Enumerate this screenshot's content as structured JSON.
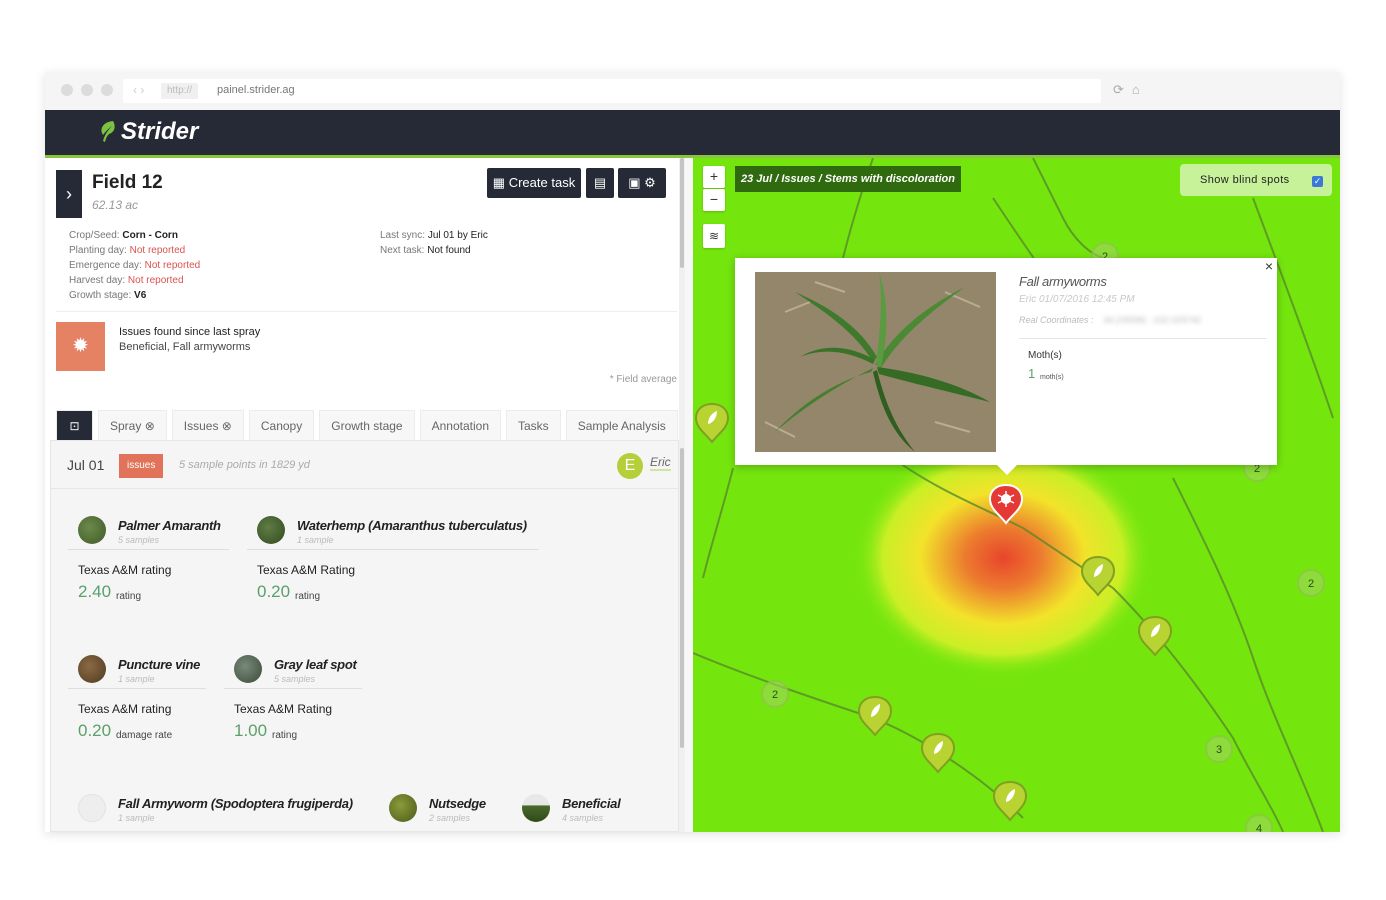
{
  "browser": {
    "protocol": "http://",
    "url": "painel.strider.ag"
  },
  "app": {
    "logo_text": "Strider"
  },
  "field": {
    "name": "Field 12",
    "area": "62.13 ac",
    "create_task_label": "Create task",
    "details": {
      "crop_label": "Crop/Seed:",
      "crop_value": "Corn - Corn",
      "planting_label": "Planting day:",
      "planting_value": "Not reported",
      "emergence_label": "Emergence day:",
      "emergence_value": "Not reported",
      "harvest_label": "Harvest day:",
      "harvest_value": "Not reported",
      "growth_label": "Growth stage:",
      "growth_value": "V6",
      "sync_label": "Last sync:",
      "sync_value": "Jul 01 by Eric",
      "next_label": "Next task:",
      "next_value": "Not found"
    },
    "issues_title": "Issues found since last spray",
    "issues_desc": "Beneficial, Fall armyworms",
    "field_average": "* Field average"
  },
  "tabs": [
    {
      "label": "Spray"
    },
    {
      "label": "Issues"
    },
    {
      "label": "Canopy"
    },
    {
      "label": "Growth stage"
    },
    {
      "label": "Annotation"
    },
    {
      "label": "Tasks"
    },
    {
      "label": "Sample Analysis"
    }
  ],
  "sample": {
    "date": "Jul 01",
    "badge": "issues",
    "summary": "5 sample points in 1829 yd",
    "user_initial": "E",
    "user_name": "Eric"
  },
  "items": [
    {
      "name": "Palmer Amaranth",
      "count": "5 samples",
      "metric": "Texas A&M rating",
      "value": "2.40",
      "unit": "rating"
    },
    {
      "name": "Waterhemp (Amaranthus tuberculatus)",
      "count": "1 sample",
      "metric": "Texas A&M Rating",
      "value": "0.20",
      "unit": "rating"
    },
    {
      "name": "Puncture vine",
      "count": "1 sample",
      "metric": "Texas A&M rating",
      "value": "0.20",
      "unit": "damage rate"
    },
    {
      "name": "Gray leaf spot",
      "count": "5 samples",
      "metric": "Texas A&M Rating",
      "value": "1.00",
      "unit": "rating"
    },
    {
      "name": "Fall Armyworm (Spodoptera frugiperda)",
      "count": "1 sample"
    },
    {
      "name": "Nutsedge",
      "count": "2 samples"
    },
    {
      "name": "Beneficial",
      "count": "4 samples"
    }
  ],
  "map": {
    "zoom_in": "+",
    "zoom_out": "−",
    "breadcrumb": "23 Jul / Issues / Stems with discoloration",
    "blind_spots_label": "Show blind spots",
    "blind_spots_checked": true,
    "clusters": [
      "2",
      "2",
      "2",
      "2",
      "3",
      "4"
    ],
    "colors": {
      "map_bg": "#74e60e",
      "heat_center": "#e8452c",
      "marker": "#b9d332",
      "issue_marker": "#e53935"
    }
  },
  "popup": {
    "close": "×",
    "title": "Fall armyworms",
    "author_time": "Eric  01/07/2016 12:45 PM",
    "coords_label": "Real Coordinates :",
    "coords_value": "34.235586, -102.029742",
    "metric": "Moth(s)",
    "value": "1",
    "unit": "moth(s)"
  }
}
